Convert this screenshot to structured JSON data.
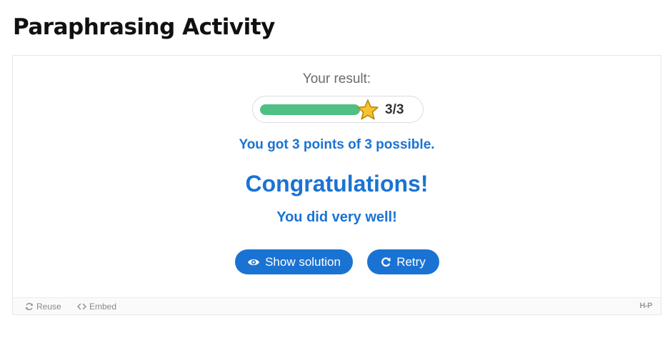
{
  "page": {
    "title": "Paraphrasing Activity"
  },
  "result": {
    "label": "Your result:",
    "score_text": "3/3",
    "progress_fraction": 1.0,
    "points_line": "You got 3 points of 3 possible.",
    "congrats": "Congratulations!",
    "feedback": "You did very well!"
  },
  "buttons": {
    "show_solution": "Show solution",
    "retry": "Retry"
  },
  "footer": {
    "reuse": "Reuse",
    "embed": "Embed",
    "logo": "H-P"
  },
  "colors": {
    "accent": "#1a73d3",
    "progress": "#4fc083",
    "star": "#f7c230"
  },
  "icons": {
    "star": "star-icon",
    "show_solution": "eye-icon",
    "retry": "retry-icon",
    "reuse": "refresh-icon",
    "embed": "code-icon"
  }
}
